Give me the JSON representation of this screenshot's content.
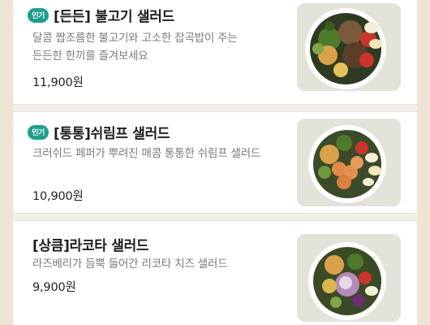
{
  "menu": {
    "items": [
      {
        "badge": "인기",
        "name": "[든든] 불고기 샐러드",
        "description": "달콤 짭조름한 불고기와 고소한 잡곡밥이 주는 든든한 한끼를 즐겨보세요",
        "price": "11,900원",
        "image": "bulgogi-salad-bowl"
      },
      {
        "badge": "인기",
        "name": "[통통]쉬림프 샐러드",
        "description": "크러쉬드 페퍼가 뿌려진 매콤 통통한 쉬림프 샐러드",
        "price": "10,900원",
        "image": "shrimp-salad-bowl"
      },
      {
        "badge": "",
        "name": "[상큼]라코타 샐러드",
        "description": "라즈베리가 듬뿍 들어간 리코타 치즈 샐러드",
        "price": "9,900원",
        "image": "ricotta-salad-bowl"
      }
    ]
  },
  "colors": {
    "badge": "#1f9e8c",
    "background": "#ede4d3"
  }
}
